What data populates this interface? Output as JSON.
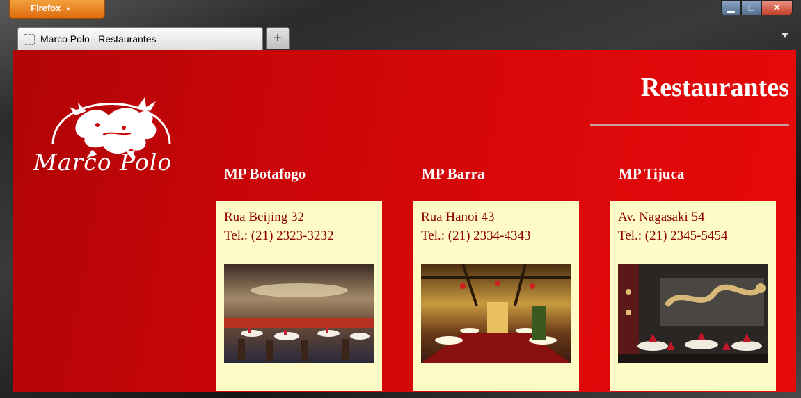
{
  "browser": {
    "menu_label": "Firefox",
    "tab_title": "Marco Polo - Restaurantes",
    "new_tab_symbol": "+"
  },
  "page": {
    "brand": "Marco Polo",
    "title": "Restaurantes",
    "colors": {
      "background": "#d00808",
      "card": "#fffbc6",
      "card_text": "#8b0000"
    },
    "restaurants": [
      {
        "name": "MP Botafogo",
        "address": "Rua Beijing 32",
        "phone": "Tel.: (21) 2323-3232"
      },
      {
        "name": "MP Barra",
        "address": "Rua Hanoi 43",
        "phone": "Tel.: (21) 2334-4343"
      },
      {
        "name": "MP Tijuca",
        "address": "Av. Nagasaki 54",
        "phone": "Tel.: (21) 2345-5454"
      }
    ]
  }
}
